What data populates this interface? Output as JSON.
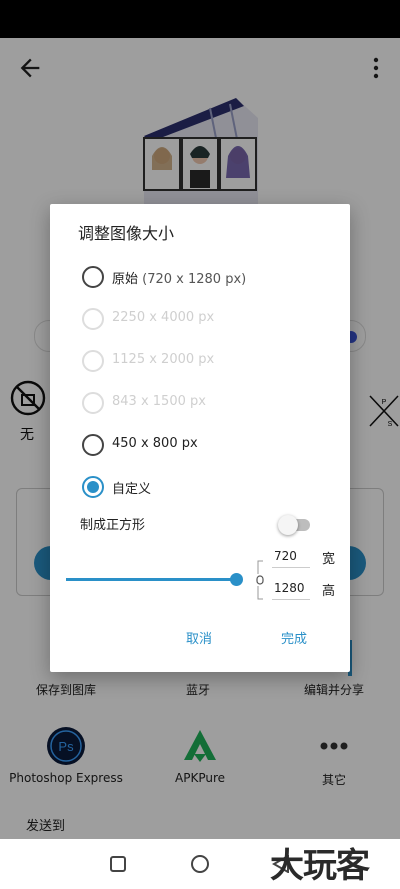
{
  "background": {
    "no_watermark_label": "无",
    "share_targets": [
      {
        "label": "保存到图库"
      },
      {
        "label": "蓝牙"
      },
      {
        "label": "编辑并分享"
      }
    ],
    "apps": [
      {
        "name": "Photoshop Express",
        "icon": "photoshop-express-icon"
      },
      {
        "name": "APKPure",
        "icon": "apkpure-icon"
      },
      {
        "name": "其它",
        "icon": "more-apps-icon"
      }
    ],
    "send_to_label": "发送到",
    "watermark_text": "大玩客"
  },
  "dialog": {
    "title": "调整图像大小",
    "options": [
      {
        "label": "原始",
        "detail": "(720 x 1280 px)",
        "state": "enabled",
        "selected": false
      },
      {
        "label": "2250 x 4000 px",
        "detail": "",
        "state": "disabled",
        "selected": false
      },
      {
        "label": "1125 x 2000 px",
        "detail": "",
        "state": "disabled",
        "selected": false
      },
      {
        "label": "843 x 1500 px",
        "detail": "",
        "state": "disabled",
        "selected": false
      },
      {
        "label": "450 x 800 px",
        "detail": "",
        "state": "enabled",
        "selected": false
      },
      {
        "label": "自定义",
        "detail": "",
        "state": "enabled",
        "selected": true
      }
    ],
    "square_label": "制成正方形",
    "square_toggle_on": false,
    "slider_level": 1.0,
    "width_value": "720",
    "width_unit": "宽",
    "height_value": "1280",
    "height_unit": "高",
    "cancel_label": "取消",
    "done_label": "完成"
  },
  "colors": {
    "accent": "#2a90c8",
    "scrim": "rgba(0,0,0,0.38)"
  }
}
